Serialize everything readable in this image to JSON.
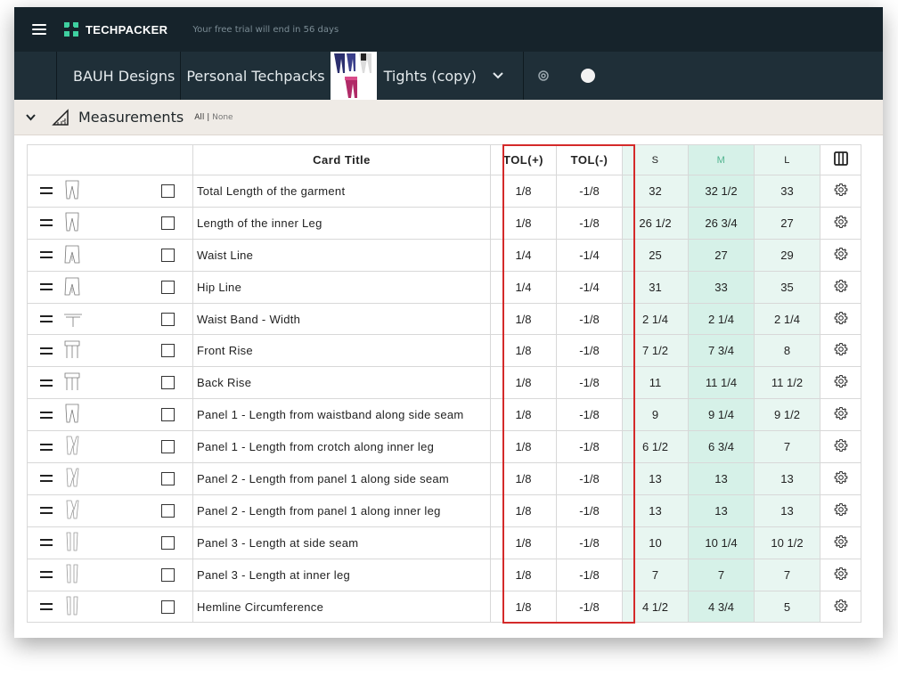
{
  "topbar": {
    "brand": "TECHPACKER",
    "trial_notice": "Your free trial will end in 56 days"
  },
  "breadcrumbs": {
    "items": [
      "BAUH Designs",
      "Personal Techpacks"
    ],
    "current": "Tights (copy)"
  },
  "section": {
    "title": "Measurements",
    "all_label": "All |",
    "none_label": " None"
  },
  "table": {
    "headers": {
      "card_title": "Card Title",
      "tol_plus": "TOL(+)",
      "tol_minus": "TOL(-)",
      "sizes": [
        "S",
        "M",
        "L"
      ]
    },
    "rows": [
      {
        "title": "Total Length of the garment",
        "tol_plus": "1/8",
        "tol_minus": "-1/8",
        "s": "32",
        "m": "32 1/2",
        "l": "33",
        "sketch": "full-leg"
      },
      {
        "title": "Length of the inner Leg",
        "tol_plus": "1/8",
        "tol_minus": "-1/8",
        "s": "26 1/2",
        "m": "26 3/4",
        "l": "27",
        "sketch": "full-leg"
      },
      {
        "title": "Waist Line",
        "tol_plus": "1/4",
        "tol_minus": "-1/4",
        "s": "25",
        "m": "27",
        "l": "29",
        "sketch": "hip"
      },
      {
        "title": "Hip Line",
        "tol_plus": "1/4",
        "tol_minus": "-1/4",
        "s": "31",
        "m": "33",
        "l": "35",
        "sketch": "hip"
      },
      {
        "title": "Waist Band - Width",
        "tol_plus": "1/8",
        "tol_minus": "-1/8",
        "s": "2 1/4",
        "m": "2 1/4",
        "l": "2 1/4",
        "sketch": "band"
      },
      {
        "title": "Front Rise",
        "tol_plus": "1/8",
        "tol_minus": "-1/8",
        "s": "7 1/2",
        "m": "7 3/4",
        "l": "8",
        "sketch": "rise"
      },
      {
        "title": "Back Rise",
        "tol_plus": "1/8",
        "tol_minus": "-1/8",
        "s": "11",
        "m": "11 1/4",
        "l": "11 1/2",
        "sketch": "rise"
      },
      {
        "title": "Panel 1 - Length from waistband along side seam",
        "tol_plus": "1/8",
        "tol_minus": "-1/8",
        "s": "9",
        "m": "9 1/4",
        "l": "9 1/2",
        "sketch": "full-leg"
      },
      {
        "title": "Panel 1 - Length from crotch along inner leg",
        "tol_plus": "1/8",
        "tol_minus": "-1/8",
        "s": "6 1/2",
        "m": "6 3/4",
        "l": "7",
        "sketch": "panel"
      },
      {
        "title": "Panel 2 - Length from panel 1 along side seam",
        "tol_plus": "1/8",
        "tol_minus": "-1/8",
        "s": "13",
        "m": "13",
        "l": "13",
        "sketch": "panel"
      },
      {
        "title": "Panel 2 - Length from panel 1 along inner leg",
        "tol_plus": "1/8",
        "tol_minus": "-1/8",
        "s": "13",
        "m": "13",
        "l": "13",
        "sketch": "panel"
      },
      {
        "title": "Panel 3 - Length at side seam",
        "tol_plus": "1/8",
        "tol_minus": "-1/8",
        "s": "10",
        "m": "10 1/4",
        "l": "10 1/2",
        "sketch": "lower-leg"
      },
      {
        "title": "Panel 3 - Length at inner leg",
        "tol_plus": "1/8",
        "tol_minus": "-1/8",
        "s": "7",
        "m": "7",
        "l": "7",
        "sketch": "lower-leg"
      },
      {
        "title": "Hemline Circumference",
        "tol_plus": "1/8",
        "tol_minus": "-1/8",
        "s": "4 1/2",
        "m": "4 3/4",
        "l": "5",
        "sketch": "lower-leg"
      }
    ]
  },
  "colors": {
    "topbar_bg": "#16232b",
    "crumbbar_bg": "#1f2f38",
    "brand_accent": "#3fd0a0",
    "highlight_border": "#d42a2a",
    "size_m_header": "#4fb38e"
  },
  "icons": [
    "menu-icon",
    "techpacker-logo-icon",
    "chevron-down-icon",
    "gear-icon",
    "status-dot",
    "measure-ruler-icon",
    "columns-icon",
    "drag-handle-icon"
  ]
}
